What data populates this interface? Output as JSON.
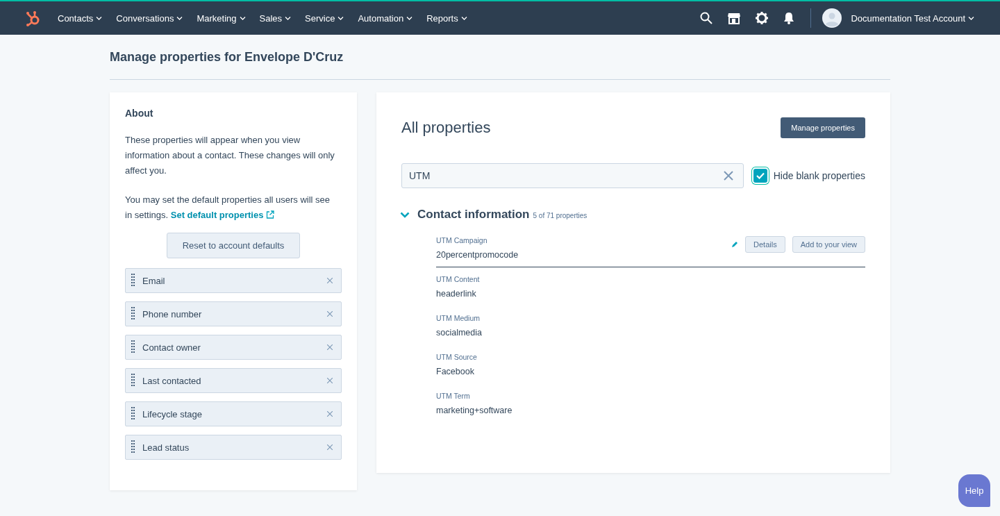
{
  "nav": {
    "menus": [
      "Contacts",
      "Conversations",
      "Marketing",
      "Sales",
      "Service",
      "Automation",
      "Reports"
    ],
    "account": "Documentation Test Account"
  },
  "page_title": "Manage properties for Envelope D'Cruz",
  "about": {
    "title": "About",
    "text": "These properties will appear when you view information about a contact. These changes will only affect you.",
    "text2": "You may set the default properties all users will see in settings.",
    "link": "Set default properties",
    "reset_button": "Reset to account defaults",
    "items": [
      "Email",
      "Phone number",
      "Contact owner",
      "Last contacted",
      "Lifecycle stage",
      "Lead status"
    ]
  },
  "all": {
    "title": "All properties",
    "manage_button": "Manage properties",
    "search": {
      "value": "UTM"
    },
    "hide_blank": {
      "label": "Hide blank properties",
      "checked": true
    },
    "section": {
      "title": "Contact information",
      "count": "5 of 71 properties",
      "expanded": true,
      "properties": [
        {
          "label": "UTM Campaign",
          "value": "20percentpromocode",
          "selected": true,
          "details": "Details",
          "add": "Add to your view"
        },
        {
          "label": "UTM Content",
          "value": "headerlink",
          "selected": false
        },
        {
          "label": "UTM Medium",
          "value": "socialmedia",
          "selected": false
        },
        {
          "label": "UTM Source",
          "value": "Facebook",
          "selected": false
        },
        {
          "label": "UTM Term",
          "value": "marketing+software",
          "selected": false
        }
      ]
    }
  },
  "help": "Help"
}
